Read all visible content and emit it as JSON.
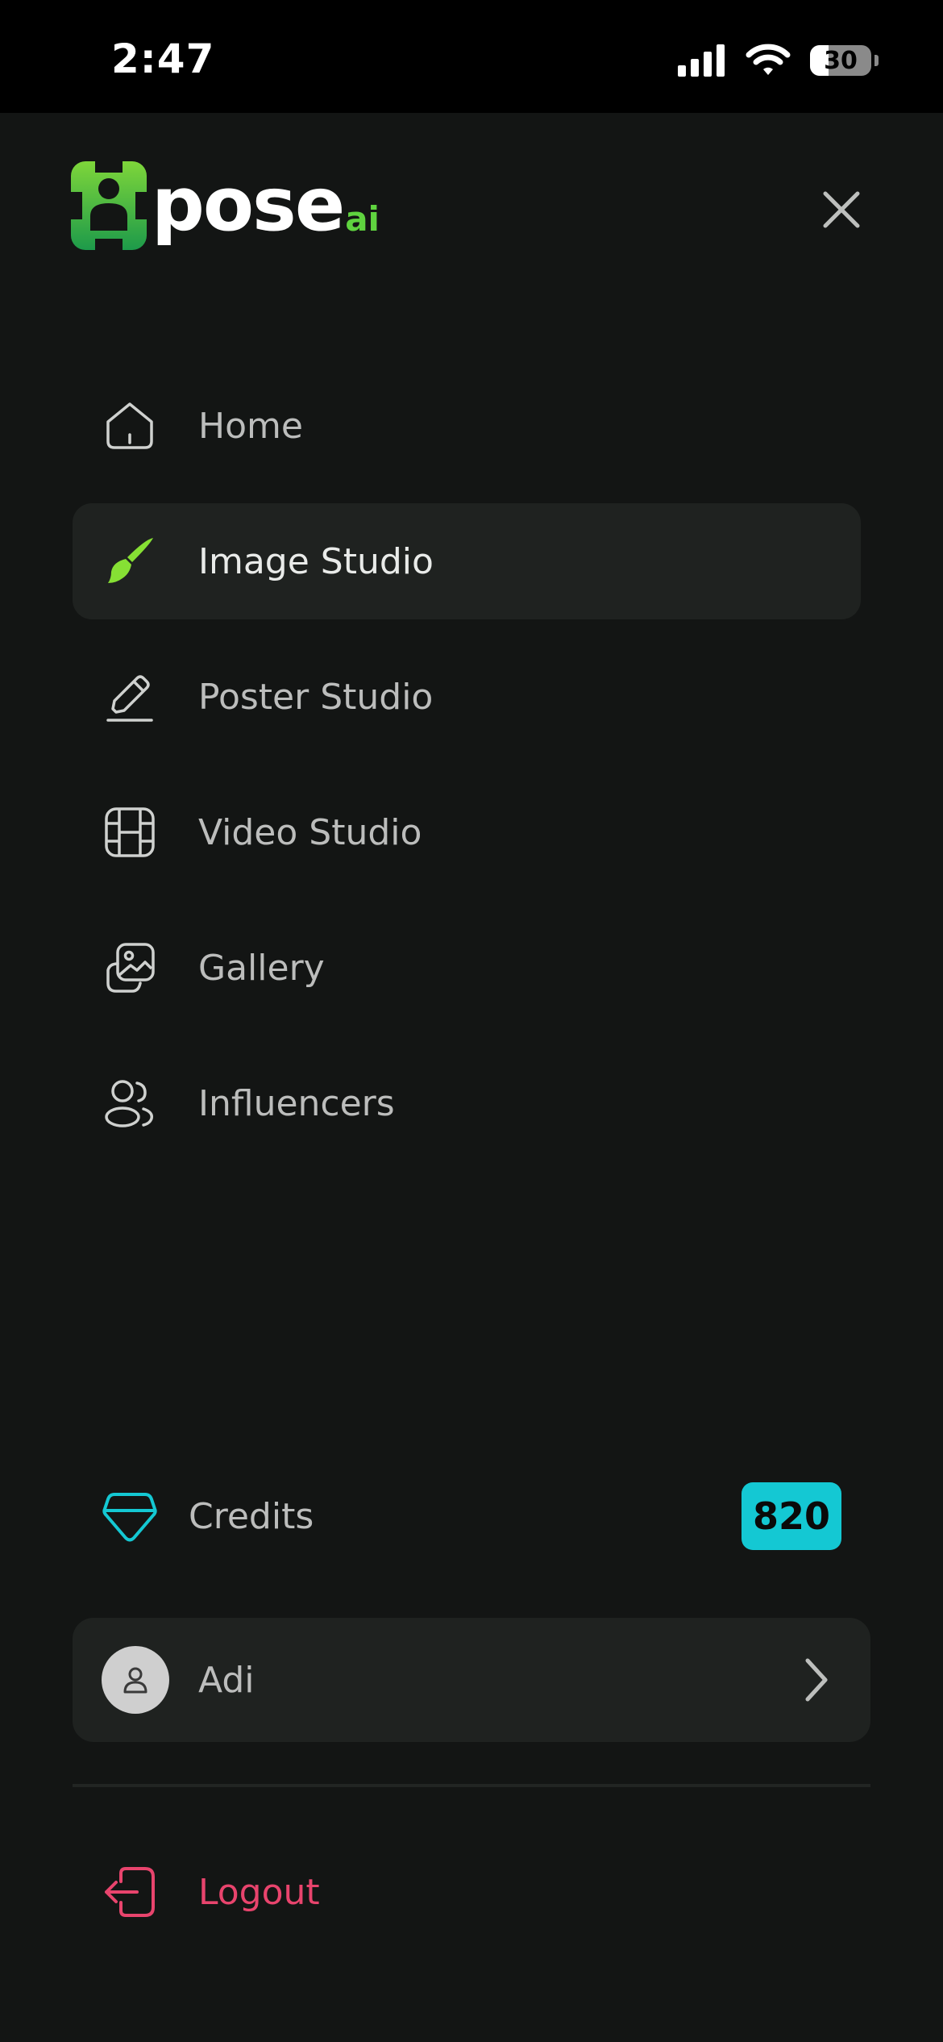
{
  "status_bar": {
    "time": "2:47",
    "battery_level": "30",
    "battery_fraction": 0.3
  },
  "header": {
    "logo_word": "pose",
    "logo_suffix": "ai",
    "close_icon": "close-icon"
  },
  "nav": {
    "items": [
      {
        "label": "Home",
        "icon": "home-icon",
        "active": false
      },
      {
        "label": "Image Studio",
        "icon": "paintbrush-icon",
        "active": true
      },
      {
        "label": "Poster Studio",
        "icon": "pencil-icon",
        "active": false
      },
      {
        "label": "Video Studio",
        "icon": "film-icon",
        "active": false
      },
      {
        "label": "Gallery",
        "icon": "gallery-icon",
        "active": false
      },
      {
        "label": "Influencers",
        "icon": "users-icon",
        "active": false
      }
    ]
  },
  "credits": {
    "label": "Credits",
    "value": "820",
    "icon": "gem-icon"
  },
  "profile": {
    "name": "Adi",
    "icon": "user-icon"
  },
  "logout": {
    "label": "Logout",
    "icon": "logout-icon"
  },
  "colors": {
    "background": "#131514",
    "accent_green": "#5fd33f",
    "active_icon": "#86e034",
    "credits_badge": "#14c8d3",
    "logout": "#e8446d"
  }
}
